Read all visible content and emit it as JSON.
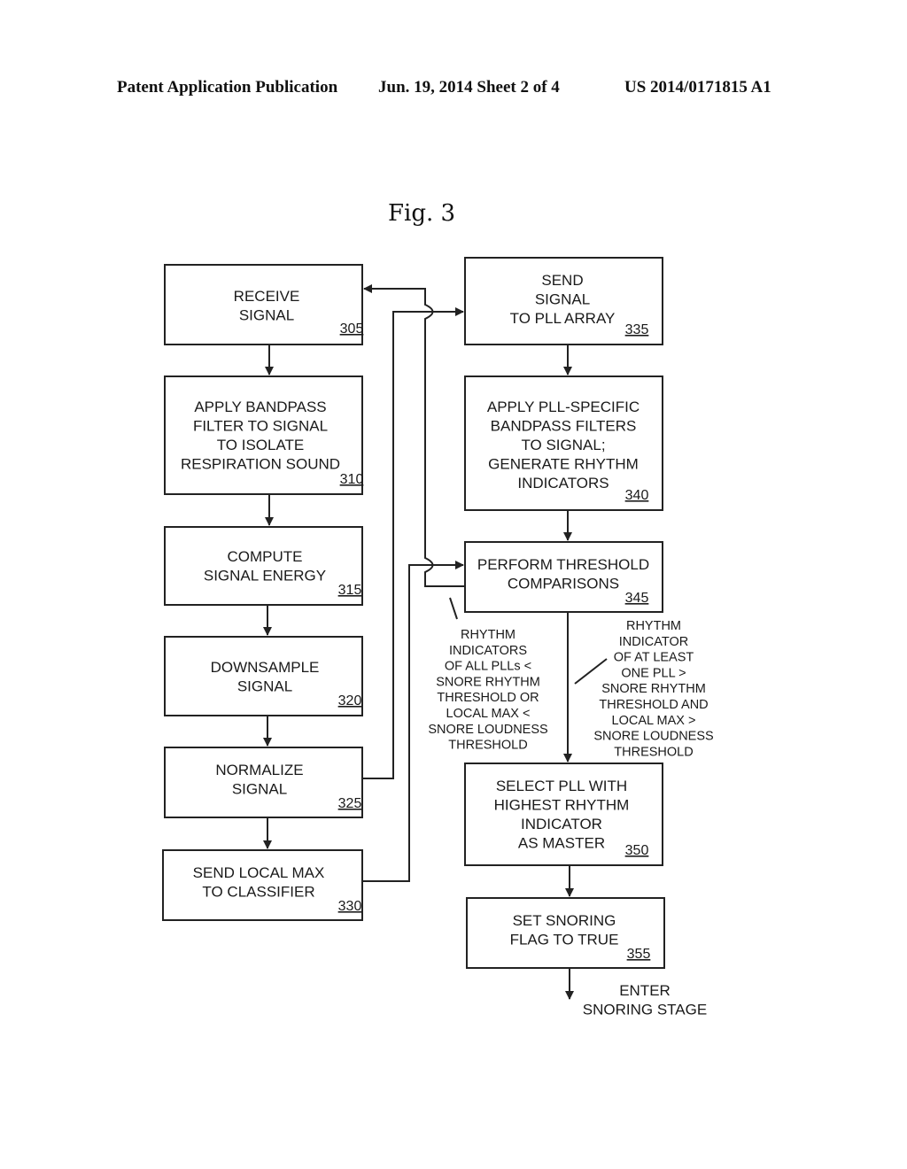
{
  "header": {
    "publication": "Patent Application Publication",
    "date_sheet": "Jun. 19, 2014  Sheet 2 of 4",
    "number": "US 2014/0171815 A1"
  },
  "figure_title": "Fig. 3",
  "boxes": [
    {
      "id": "305",
      "lines": [
        "RECEIVE",
        "SIGNAL"
      ],
      "ref": "305"
    },
    {
      "id": "310",
      "lines": [
        "APPLY BANDPASS",
        "FILTER TO SIGNAL",
        "TO ISOLATE",
        "RESPIRATION  SOUND"
      ],
      "ref": "310"
    },
    {
      "id": "315",
      "lines": [
        "COMPUTE",
        "SIGNAL ENERGY"
      ],
      "ref": "315"
    },
    {
      "id": "320",
      "lines": [
        "DOWNSAMPLE",
        "SIGNAL"
      ],
      "ref": "320"
    },
    {
      "id": "325",
      "lines": [
        "NORMALIZE",
        "SIGNAL"
      ],
      "ref": "325"
    },
    {
      "id": "330",
      "lines": [
        "SEND LOCAL MAX",
        "TO CLASSIFIER"
      ],
      "ref": "330"
    },
    {
      "id": "335",
      "lines": [
        "SEND",
        "SIGNAL",
        "TO PLL ARRAY"
      ],
      "ref": "335"
    },
    {
      "id": "340",
      "lines": [
        "APPLY PLL-SPECIFIC",
        "BANDPASS FILTERS",
        "TO SIGNAL;",
        "GENERATE RHYTHM",
        "INDICATORS"
      ],
      "ref": "340"
    },
    {
      "id": "345",
      "lines": [
        "PERFORM THRESHOLD",
        "COMPARISONS"
      ],
      "ref": "345"
    },
    {
      "id": "350",
      "lines": [
        "SELECT PLL WITH",
        "HIGHEST RHYTHM",
        "INDICATOR",
        "AS MASTER"
      ],
      "ref": "350"
    },
    {
      "id": "355",
      "lines": [
        "SET SNORING",
        "FLAG TO TRUE"
      ],
      "ref": "355"
    }
  ],
  "branch_labels": {
    "no_snore": [
      "RHYTHM",
      "INDICATORS",
      "OF ALL PLLs <",
      "SNORE RHYTHM",
      "THRESHOLD OR",
      "LOCAL MAX <",
      "SNORE LOUDNESS",
      "THRESHOLD"
    ],
    "snore": [
      "RHYTHM",
      "INDICATOR",
      "OF AT LEAST",
      "ONE PLL >",
      "SNORE RHYTHM",
      "THRESHOLD AND",
      "LOCAL MAX >",
      "SNORE LOUDNESS",
      "THRESHOLD"
    ]
  },
  "exit_label": [
    "ENTER",
    "SNORING STAGE"
  ]
}
